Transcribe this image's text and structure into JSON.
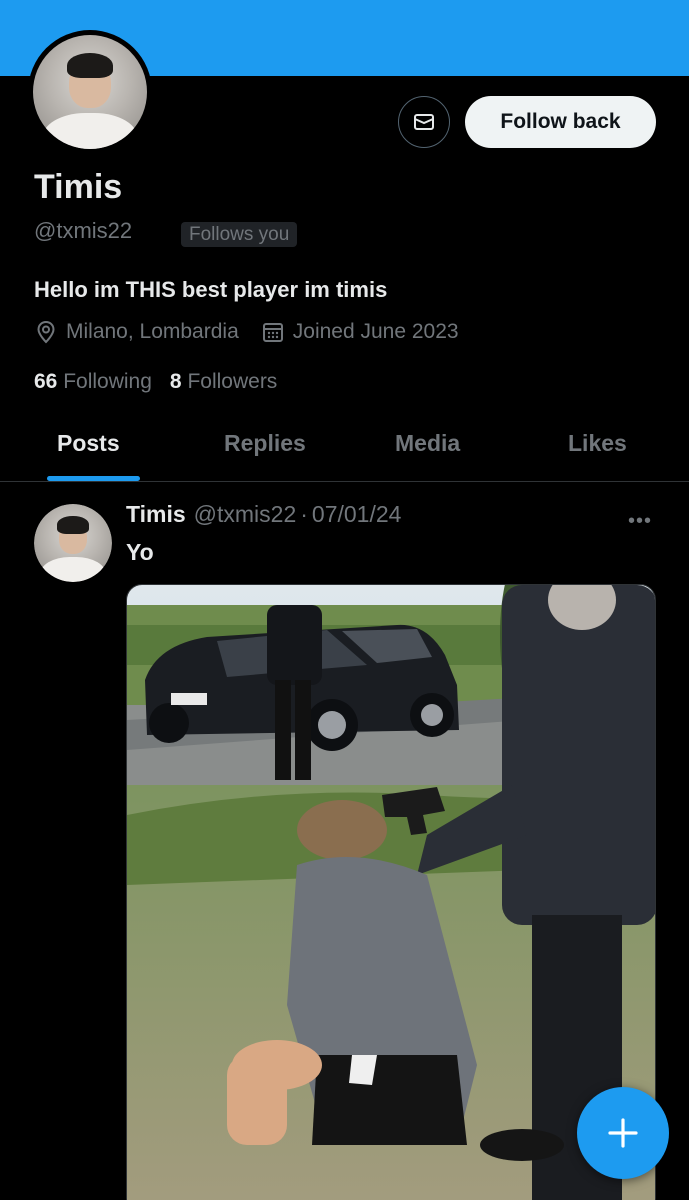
{
  "profile": {
    "name": "Timis",
    "handle": "@txmis22",
    "follows_you_badge": "Follows you",
    "bio": "Hello im THIS best player im timis",
    "location": "Milano, Lombardia",
    "joined": "Joined June 2023",
    "following_count": "66",
    "following_label": "Following",
    "followers_count": "8",
    "followers_label": "Followers"
  },
  "actions": {
    "message_icon": "envelope-icon",
    "follow_label": "Follow back"
  },
  "tabs": [
    {
      "label": "Posts",
      "active": true
    },
    {
      "label": "Replies",
      "active": false
    },
    {
      "label": "Media",
      "active": false
    },
    {
      "label": "Likes",
      "active": false
    }
  ],
  "post": {
    "name": "Timis",
    "handle": "@txmis22",
    "separator": "·",
    "date": "07/01/24",
    "more": "•••",
    "text": "Yo"
  },
  "colors": {
    "accent": "#1d9bf0",
    "background": "#000000",
    "text_primary": "#e7e9ea",
    "text_secondary": "#71767b"
  },
  "fab_icon": "plus-icon"
}
